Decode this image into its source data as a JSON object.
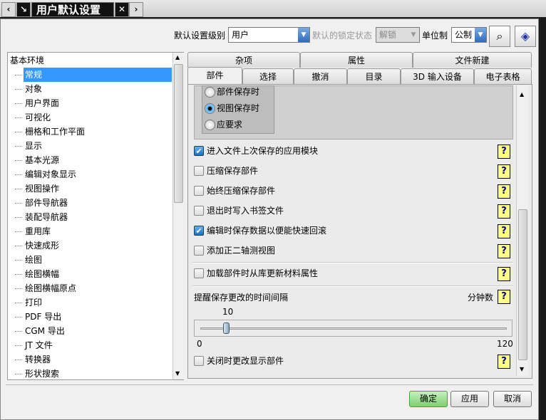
{
  "window": {
    "title": "用户默认设置"
  },
  "toolbar": {
    "level_label": "默认设置级别",
    "level_value": "用户",
    "lock_label": "默认的锁定状态",
    "lock_value": "解锁",
    "unit_label": "单位制",
    "unit_value": "公制"
  },
  "tree": {
    "root": "基本环境",
    "items": [
      "常规",
      "对象",
      "用户界面",
      "可视化",
      "栅格和工作平面",
      "显示",
      "基本光源",
      "编辑对象显示",
      "视图操作",
      "部件导航器",
      "装配导航器",
      "重用库",
      "快速成形",
      "绘图",
      "绘图横幅",
      "绘图横幅原点",
      "打印",
      "PDF 导出",
      "CGM 导出",
      "JT 文件",
      "转换器",
      "形状搜索"
    ],
    "selected": "常规"
  },
  "tabs": {
    "row1": [
      "杂项",
      "属性",
      "文件新建"
    ],
    "row2": [
      "部件",
      "选择",
      "撤消",
      "目录",
      "3D 输入设备",
      "电子表格"
    ],
    "active": "部件"
  },
  "radios": [
    {
      "label": "部件保存时",
      "checked": false
    },
    {
      "label": "视图保存时",
      "checked": true
    },
    {
      "label": "应要求",
      "checked": false
    }
  ],
  "checks": [
    {
      "label": "进入文件上次保存的应用模块",
      "checked": true
    },
    {
      "label": "压缩保存部件",
      "checked": false
    },
    {
      "label": "始终压缩保存部件",
      "checked": false
    },
    {
      "label": "退出时写入书签文件",
      "checked": false
    },
    {
      "label": "编辑时保存数据以便能快速回滚",
      "checked": true
    },
    {
      "label": "添加正二轴测视图",
      "checked": false
    },
    {
      "label": "加载部件时从库更新材料属性",
      "checked": false
    }
  ],
  "slider": {
    "label": "提醒保存更改的时间间隔",
    "unit": "分钟数",
    "value": "10",
    "min": "0",
    "max": "120"
  },
  "last_check": {
    "label": "关闭时更改显示部件",
    "checked": false
  },
  "buttons": {
    "ok": "确定",
    "apply": "应用",
    "cancel": "取消"
  },
  "help_glyph": "?"
}
